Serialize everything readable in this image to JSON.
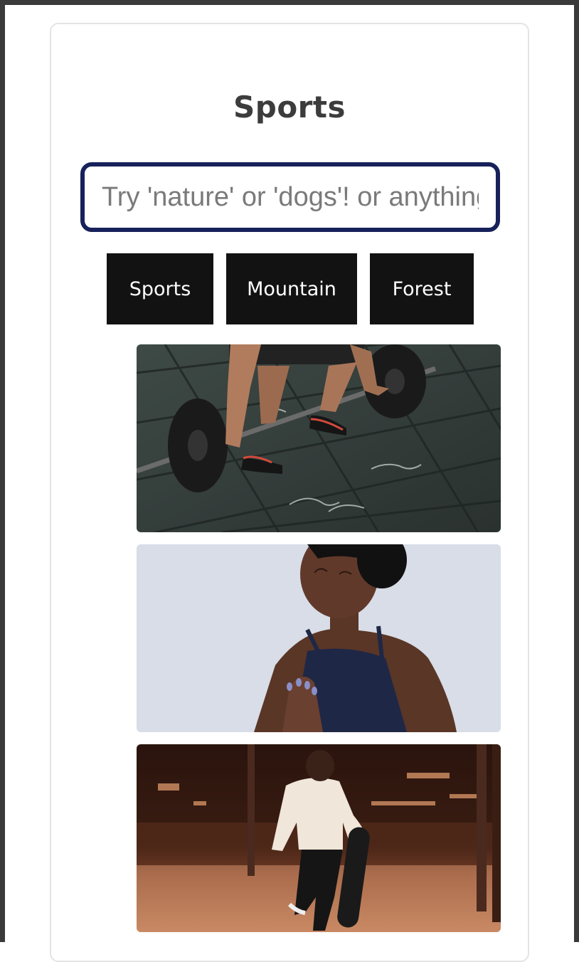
{
  "page": {
    "title": "Sports"
  },
  "search": {
    "placeholder": "Try 'nature' or 'dogs'! or anything"
  },
  "categories": [
    {
      "label": "Sports"
    },
    {
      "label": "Mountain"
    },
    {
      "label": "Forest"
    }
  ],
  "photos": [
    {
      "subject": "deadlift barbell on tiled floor"
    },
    {
      "subject": "woman in meditation pose"
    },
    {
      "subject": "man carrying skateboard at night"
    }
  ],
  "colors": {
    "search_border": "#17215a",
    "button_bg": "#121212",
    "title": "#3c3c3c"
  }
}
